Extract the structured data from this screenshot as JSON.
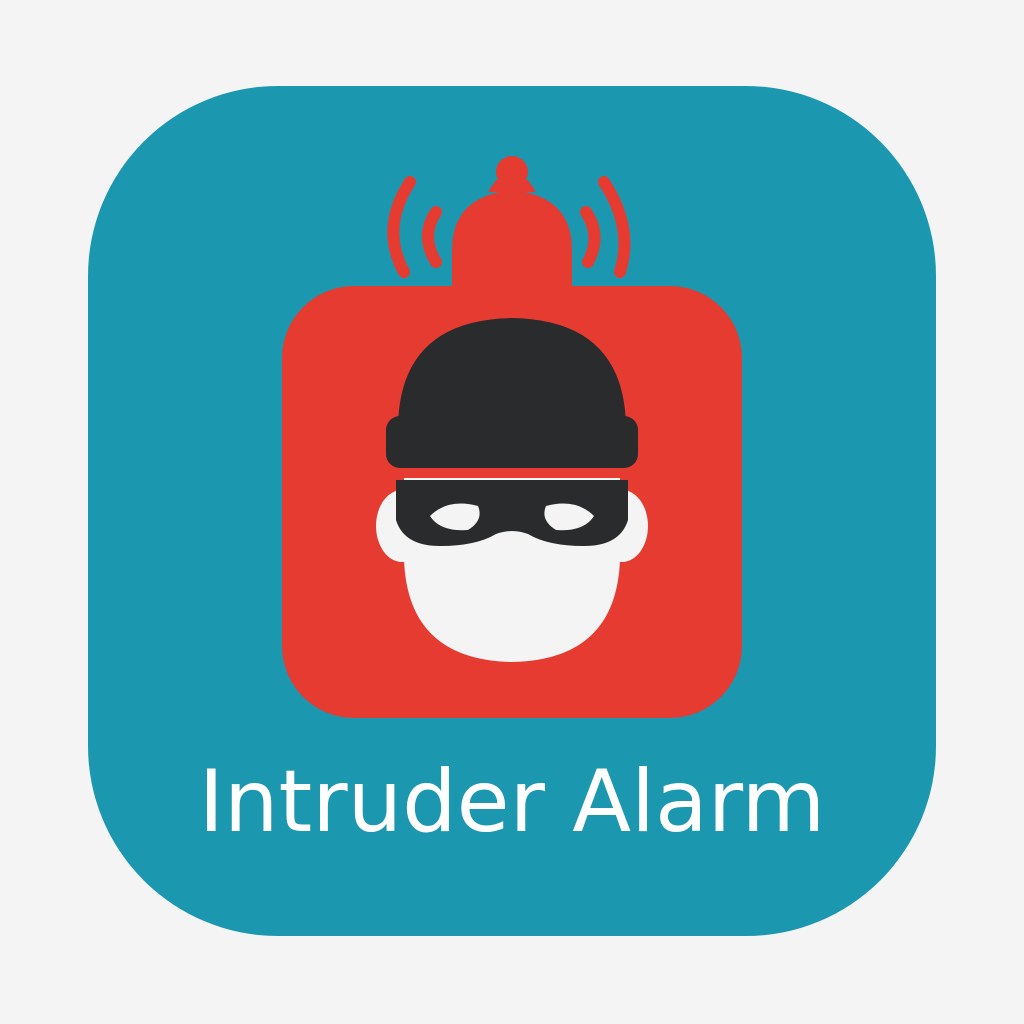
{
  "app_icon": {
    "name": "Intruder Alarm",
    "icon": "intruder-alarm-icon",
    "background_color": "#1b98b0"
  },
  "artwork": {
    "alarm_icon": "alarm-bell-icon",
    "alarm_color": "#e63b31",
    "burglar_icon": "masked-burglar-icon",
    "mask_color": "#2a2b2c",
    "face_color": "#f4f4f4"
  },
  "page": {
    "background_color": "#f4f4f4"
  }
}
